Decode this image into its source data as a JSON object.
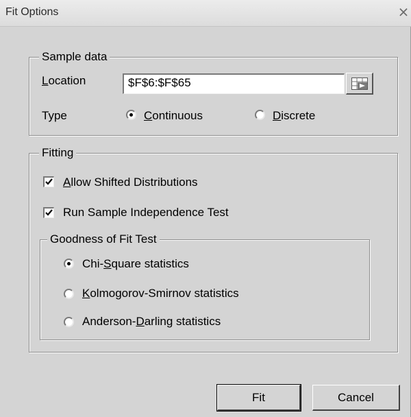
{
  "window": {
    "title": "Fit Options",
    "close_glyph": "⨯"
  },
  "sample_data": {
    "legend": "Sample data",
    "location_label_prefix": "L",
    "location_label_rest": "ocation",
    "location_value": "$F$6:$F$65",
    "ref_button_icon": "cell-reference-icon",
    "type_label": "Type",
    "continuous_prefix": "C",
    "continuous_rest": "ontinuous",
    "discrete_prefix": "D",
    "discrete_rest": "iscrete",
    "selected_type": "continuous"
  },
  "fitting": {
    "legend": "Fitting",
    "allow_shifted_prefix": "A",
    "allow_shifted_rest": "llow Shifted Distributions",
    "allow_shifted_checked": true,
    "run_independence_label": "Run Sample Independence Test",
    "run_independence_checked": true,
    "gof": {
      "legend": "Goodness of Fit Test",
      "chi_pre": "Chi-",
      "chi_u": "S",
      "chi_post": "quare statistics",
      "ks_u": "K",
      "ks_post": "olmogorov-Smirnov statistics",
      "ad_pre": "Anderson-",
      "ad_u": "D",
      "ad_post": "arling statistics",
      "selected": "chi-square"
    }
  },
  "buttons": {
    "fit": "Fit",
    "cancel": "Cancel"
  }
}
